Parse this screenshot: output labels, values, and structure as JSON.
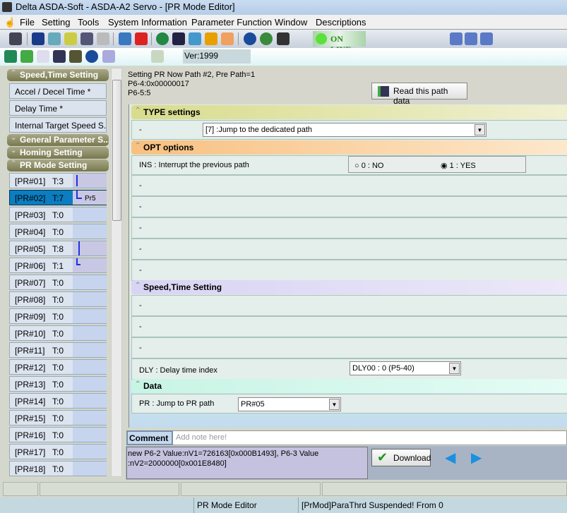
{
  "window": {
    "title": "Delta ASDA-Soft - ASDA-A2 Servo - [PR Mode Editor]"
  },
  "menu": [
    "File",
    "Setting",
    "Tools",
    "System Information",
    "Parameter Function",
    "Window",
    "Descriptions"
  ],
  "toolbar": {
    "online_label": "ON LINE",
    "version": "Ver:1999",
    "online_color": "#5ce03c"
  },
  "sidebar": {
    "groups": [
      {
        "label": "Speed,Time Setting",
        "expanded": true,
        "items": [
          "Accel / Decel Time  *",
          "Delay Time  *",
          "Internal Target Speed S..."
        ]
      },
      {
        "label": "General Parameter S...",
        "expanded": false
      },
      {
        "label": "Homing Setting",
        "expanded": false
      },
      {
        "label": "PR Mode Setting",
        "expanded": true
      }
    ],
    "pr_paths": [
      {
        "name": "[PR#01]",
        "type": "T:3"
      },
      {
        "name": "[PR#02]",
        "type": "T:7",
        "link": "Pr5",
        "selected": true
      },
      {
        "name": "[PR#03]",
        "type": "T:0"
      },
      {
        "name": "[PR#04]",
        "type": "T:0"
      },
      {
        "name": "[PR#05]",
        "type": "T:8"
      },
      {
        "name": "[PR#06]",
        "type": "T:1"
      },
      {
        "name": "[PR#07]",
        "type": "T:0"
      },
      {
        "name": "[PR#08]",
        "type": "T:0"
      },
      {
        "name": "[PR#09]",
        "type": "T:0"
      },
      {
        "name": "[PR#10]",
        "type": "T:0"
      },
      {
        "name": "[PR#11]",
        "type": "T:0"
      },
      {
        "name": "[PR#12]",
        "type": "T:0"
      },
      {
        "name": "[PR#13]",
        "type": "T:0"
      },
      {
        "name": "[PR#14]",
        "type": "T:0"
      },
      {
        "name": "[PR#15]",
        "type": "T:0"
      },
      {
        "name": "[PR#16]",
        "type": "T:0"
      },
      {
        "name": "[PR#17]",
        "type": "T:0"
      },
      {
        "name": "[PR#18]",
        "type": "T:0"
      }
    ]
  },
  "main": {
    "info": [
      "Setting PR Now Path #2, Pre Path=1",
      "P6-4:0x00000017",
      "P6-5:5"
    ],
    "read_button": "Read this path data",
    "type_section": {
      "title": "TYPE settings",
      "label": "-",
      "value": "[7] :Jump to the dedicated path"
    },
    "opt_section": {
      "title": "OPT options",
      "ins_label": "INS : Interrupt the previous path",
      "options": [
        "0 : NO",
        "1 : YES"
      ],
      "selected": "1 : YES",
      "empty_rows": [
        "-",
        "-",
        "-",
        "-",
        "-"
      ]
    },
    "speed_section": {
      "title": "Speed,Time Setting",
      "empty_rows": [
        "-",
        "-",
        "-"
      ],
      "dly_label": "DLY : Delay time index",
      "dly_value": "DLY00 : 0 (P5-40)"
    },
    "data_section": {
      "title": "Data",
      "pr_label": "PR : Jump to PR path",
      "pr_value": "PR#05"
    },
    "comment_label": "Comment :",
    "comment_placeholder": "Add note here!",
    "message": "new P6-2 Value:nV1=726163[0x000B1493], P6-3 Value :nV2=2000000[0x001E8480]",
    "download_button": "Download"
  },
  "status": {
    "panel": "PR Mode Editor",
    "message": "[PrMod]ParaThrd Suspended! From 0"
  }
}
